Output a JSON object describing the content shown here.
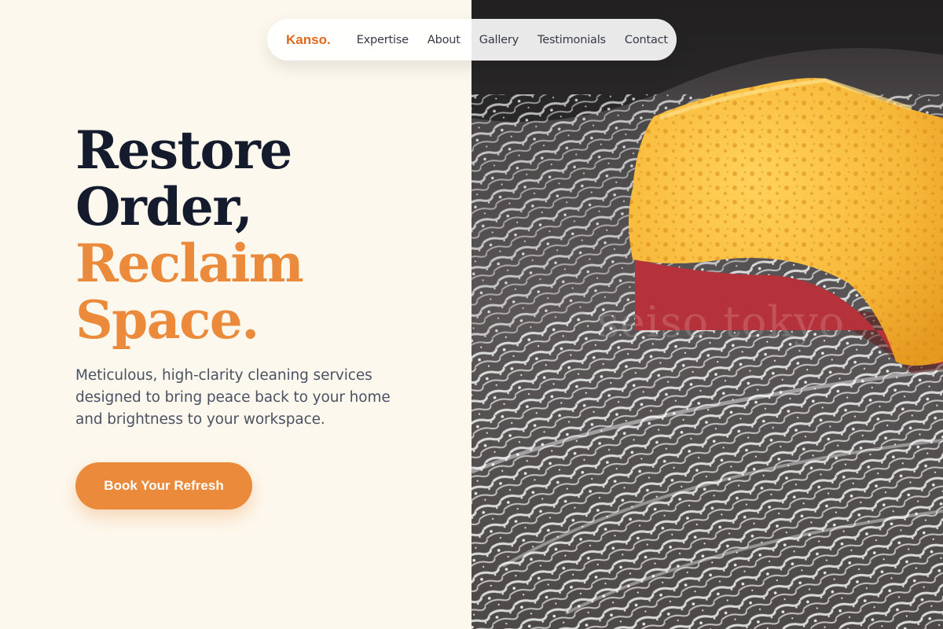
{
  "nav": {
    "brand": "Kanso.",
    "links": [
      {
        "label": "Expertise"
      },
      {
        "label": "About"
      },
      {
        "label": "Gallery"
      },
      {
        "label": "Testimonials"
      },
      {
        "label": "Contact"
      }
    ]
  },
  "hero": {
    "title_line1": "Restore",
    "title_line2": "Order,",
    "title_line3": "Reclaim",
    "title_line4": "Space.",
    "description": "Meticulous, high-clarity cleaning services designed to bring peace back to your home and brightness to your workspace.",
    "cta_label": "Book Your Refresh"
  },
  "image": {
    "subject": "yellow sponge on soapy glass",
    "watermark": "seiso tokyo"
  },
  "colors": {
    "accent": "#ea8a3a",
    "brand": "#e06a1c",
    "heading": "#131b2c",
    "background": "#fdf8ee"
  }
}
